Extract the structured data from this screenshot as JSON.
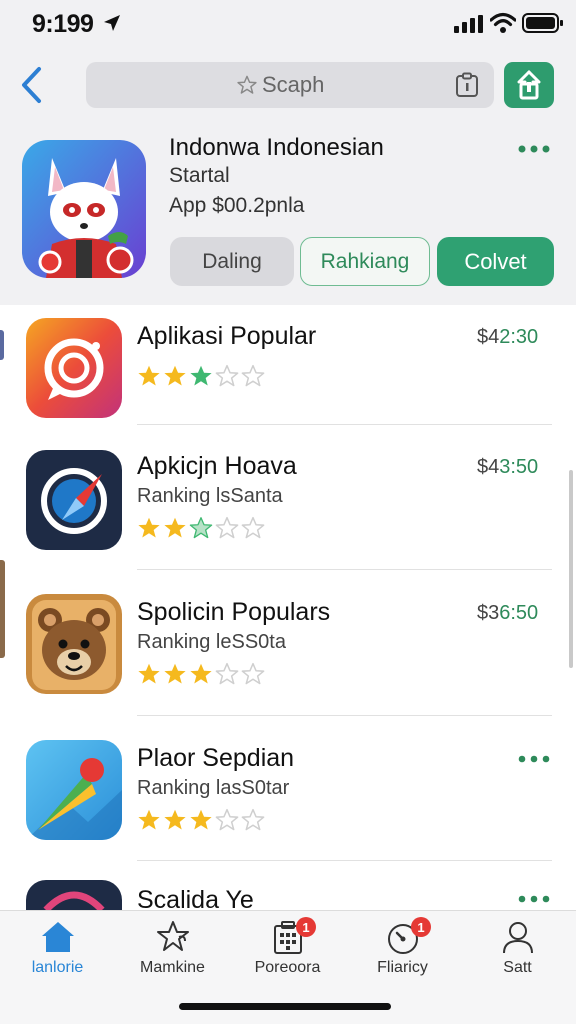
{
  "status_bar": {
    "time": "9:199"
  },
  "search": {
    "text": "Scaph"
  },
  "featured": {
    "title": "Indonwa Indonesian",
    "subtitle": "Startal",
    "price": "App $00.2pnla",
    "buttons": {
      "dal": "Daling",
      "rank": "Rahkiang",
      "col": "Colvet"
    }
  },
  "apps": [
    {
      "name": "Aplikasi Popular",
      "subtitle": "",
      "price_main": "$4",
      "price_cents": "2:30",
      "rating": 3,
      "icon": "camera-chat-icon"
    },
    {
      "name": "Apkicjn Hoava",
      "subtitle": "Ranking lsSanta",
      "price_main": "$4",
      "price_cents": "3:50",
      "rating": 2.5,
      "icon": "compass-icon"
    },
    {
      "name": "Spolicin Populars",
      "subtitle": "Ranking leSS0ta",
      "price_main": "$3",
      "price_cents": "6:50",
      "rating": 3,
      "icon": "bear-icon"
    },
    {
      "name": "Plaor Sepdian",
      "subtitle": "Ranking lasS0tar",
      "price_main": "",
      "price_cents": "",
      "rating": 3,
      "icon": "map-pin-icon"
    },
    {
      "name": "Scalida Ye",
      "subtitle": "",
      "price_main": "",
      "price_cents": "",
      "rating": 0,
      "icon": "ring-icon"
    }
  ],
  "tabs": [
    {
      "label": "lanlorie",
      "icon": "home-icon",
      "badge": ""
    },
    {
      "label": "Mamkine",
      "icon": "star-puzzle-icon",
      "badge": ""
    },
    {
      "label": "Poreoora",
      "icon": "calendar-icon",
      "badge": "1"
    },
    {
      "label": "Fliaricy",
      "icon": "gauge-icon",
      "badge": "1"
    },
    {
      "label": "Satt",
      "icon": "person-icon",
      "badge": ""
    }
  ],
  "colors": {
    "accent_green": "#2fa172",
    "tab_active": "#2a86d6",
    "star_gold": "#f5b91e",
    "star_green": "#3fb871"
  }
}
